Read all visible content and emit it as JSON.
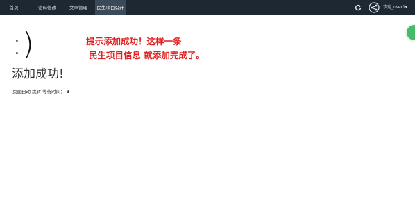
{
  "navbar": {
    "items": [
      {
        "label": "首页",
        "active": false
      },
      {
        "label": "密码修改",
        "active": false
      },
      {
        "label": "文章管理",
        "active": false
      },
      {
        "label": "民生项目公开",
        "active": true
      }
    ],
    "icons": {
      "refresh": "refresh-icon",
      "share": "share-icon"
    },
    "user_label": "欢迎_user1▾"
  },
  "content": {
    "smile": ":)",
    "annotation": {
      "line1": "提示添加成功！这样一条",
      "line2": "民生项目信息 就添加完成了。",
      "color": "#e02020"
    },
    "title": "添加成功!",
    "redirect": {
      "prefix": "页面自动",
      "link": "跳转",
      "middle": "等待时间：",
      "seconds": "3"
    }
  },
  "floating_button": {
    "icon": "float-action-icon",
    "color": "#49b96a"
  },
  "colors": {
    "navbar_bg": "#1e2833",
    "active_tab_bg": "#3b4a58",
    "text": "#333333"
  }
}
